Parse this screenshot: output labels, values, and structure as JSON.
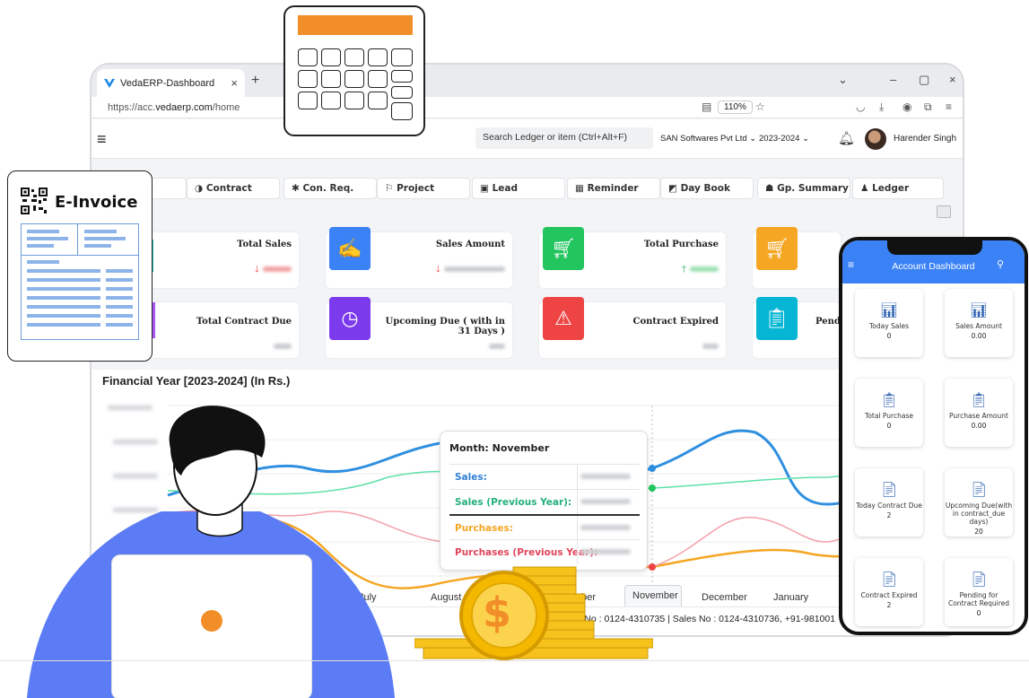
{
  "browser": {
    "tab_title": "VedaERP-Dashboard",
    "tab_close": "×",
    "new_tab": "+",
    "url_prefix": "https://acc.",
    "url_domain": "vedaerp.com",
    "url_path": "/home",
    "zoom": "110%",
    "win_min": "–",
    "win_max": "▢",
    "win_close": "×",
    "win_dropdown": "⌄"
  },
  "header": {
    "menu_icon": "≡",
    "search_placeholder": "Search Ledger or item (Ctrl+Alt+F)",
    "company": "SAN Softwares Pvt Ltd",
    "financial_year": "2023-2024",
    "user_name": "Harender Singh"
  },
  "nav": [
    {
      "icon": "◑",
      "label": "Contract"
    },
    {
      "icon": "✱",
      "label": "Con. Req."
    },
    {
      "icon": "⚐",
      "label": "Project"
    },
    {
      "icon": "▣",
      "label": "Lead"
    },
    {
      "icon": "▦",
      "label": "Reminder"
    },
    {
      "icon": "◩",
      "label": "Day Book"
    },
    {
      "icon": "☗",
      "label": "Gp. Summary"
    },
    {
      "icon": "♟",
      "label": "Ledger"
    }
  ],
  "cards_row1": [
    {
      "title": "Total Sales",
      "color": "#2bc4b4"
    },
    {
      "title": "Sales Amount",
      "color": "#3b82f6"
    },
    {
      "title": "Total Purchase",
      "color": "#22c55e"
    },
    {
      "title": "",
      "color": "#f5a623"
    }
  ],
  "cards_row2": [
    {
      "title": "Total Contract Due",
      "color": "#a855f7"
    },
    {
      "title": "Upcoming Due ( with in 31 Days )",
      "color": "#7c3aed"
    },
    {
      "title": "Contract Expired",
      "color": "#ef4444"
    },
    {
      "title": "Pendi",
      "color": "#06b6d4"
    }
  ],
  "chart": {
    "title": "Financial Year [2023-2024] (In Rs.)",
    "months": [
      "July",
      "August",
      "ober",
      "November",
      "December",
      "January"
    ],
    "tooltip": {
      "header": "Month: November",
      "rows": [
        {
          "label": "Sales:",
          "color": "#3b82f6"
        },
        {
          "label": "Sales (Previous Year):",
          "color": "#22c55e"
        },
        {
          "label": "Purchases:",
          "color": "#f5a623"
        },
        {
          "label": "Purchases (Previous Year):",
          "color": "#ef4444"
        }
      ]
    }
  },
  "footer_text": "rt No : 0124-4310735 | Sales No : 0124-4310736, +91-981001",
  "einvoice": {
    "title": "E-Invoice"
  },
  "phone": {
    "title": "Account Dashboard",
    "cards": [
      {
        "label": "Today Sales",
        "value": "0"
      },
      {
        "label": "Sales Amount",
        "value": "0.00"
      },
      {
        "label": "Total Purchase",
        "value": "0"
      },
      {
        "label": "Purchase Amount",
        "value": "0.00"
      },
      {
        "label": "Today Contract Due",
        "value": "2"
      },
      {
        "label": "Upcoming Due(with in contract_due days)",
        "value": "20"
      },
      {
        "label": "Contract Expired",
        "value": "2"
      },
      {
        "label": "Pending for Contract Required",
        "value": "0"
      }
    ]
  },
  "coin_symbol": "$"
}
